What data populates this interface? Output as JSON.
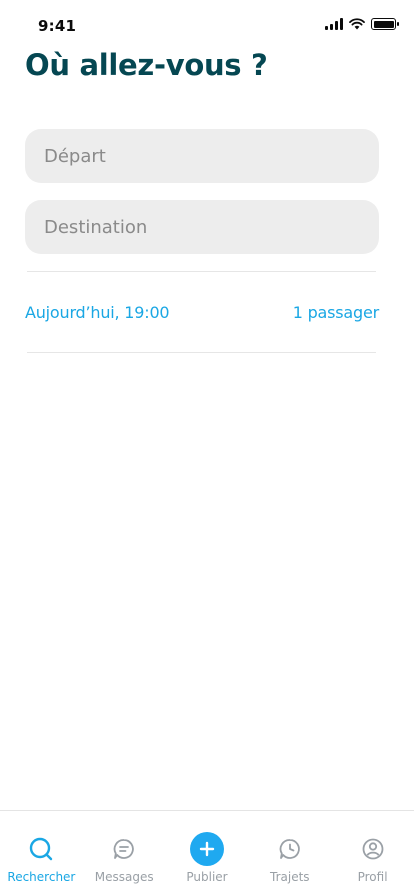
{
  "status_bar": {
    "time": "9:41"
  },
  "header": {
    "title": "Où allez-vous ?"
  },
  "search": {
    "departure_placeholder": "Départ",
    "departure_value": "",
    "destination_placeholder": "Destination",
    "destination_value": ""
  },
  "options": {
    "date_time": "Aujourd’hui, 19:00",
    "passengers": "1 passager"
  },
  "tabs": [
    {
      "label": "Rechercher",
      "icon": "search-icon",
      "active": true
    },
    {
      "label": "Messages",
      "icon": "chat-icon",
      "active": false
    },
    {
      "label": "Publier",
      "icon": "plus-icon",
      "active": false
    },
    {
      "label": "Trajets",
      "icon": "clock-icon",
      "active": false
    },
    {
      "label": "Profil",
      "icon": "user-icon",
      "active": false
    }
  ],
  "colors": {
    "primary_text": "#054752",
    "accent": "#1aa7e4",
    "publish_button": "#1fa9f0",
    "inactive": "#9aa0a6",
    "input_background": "#ededed"
  }
}
